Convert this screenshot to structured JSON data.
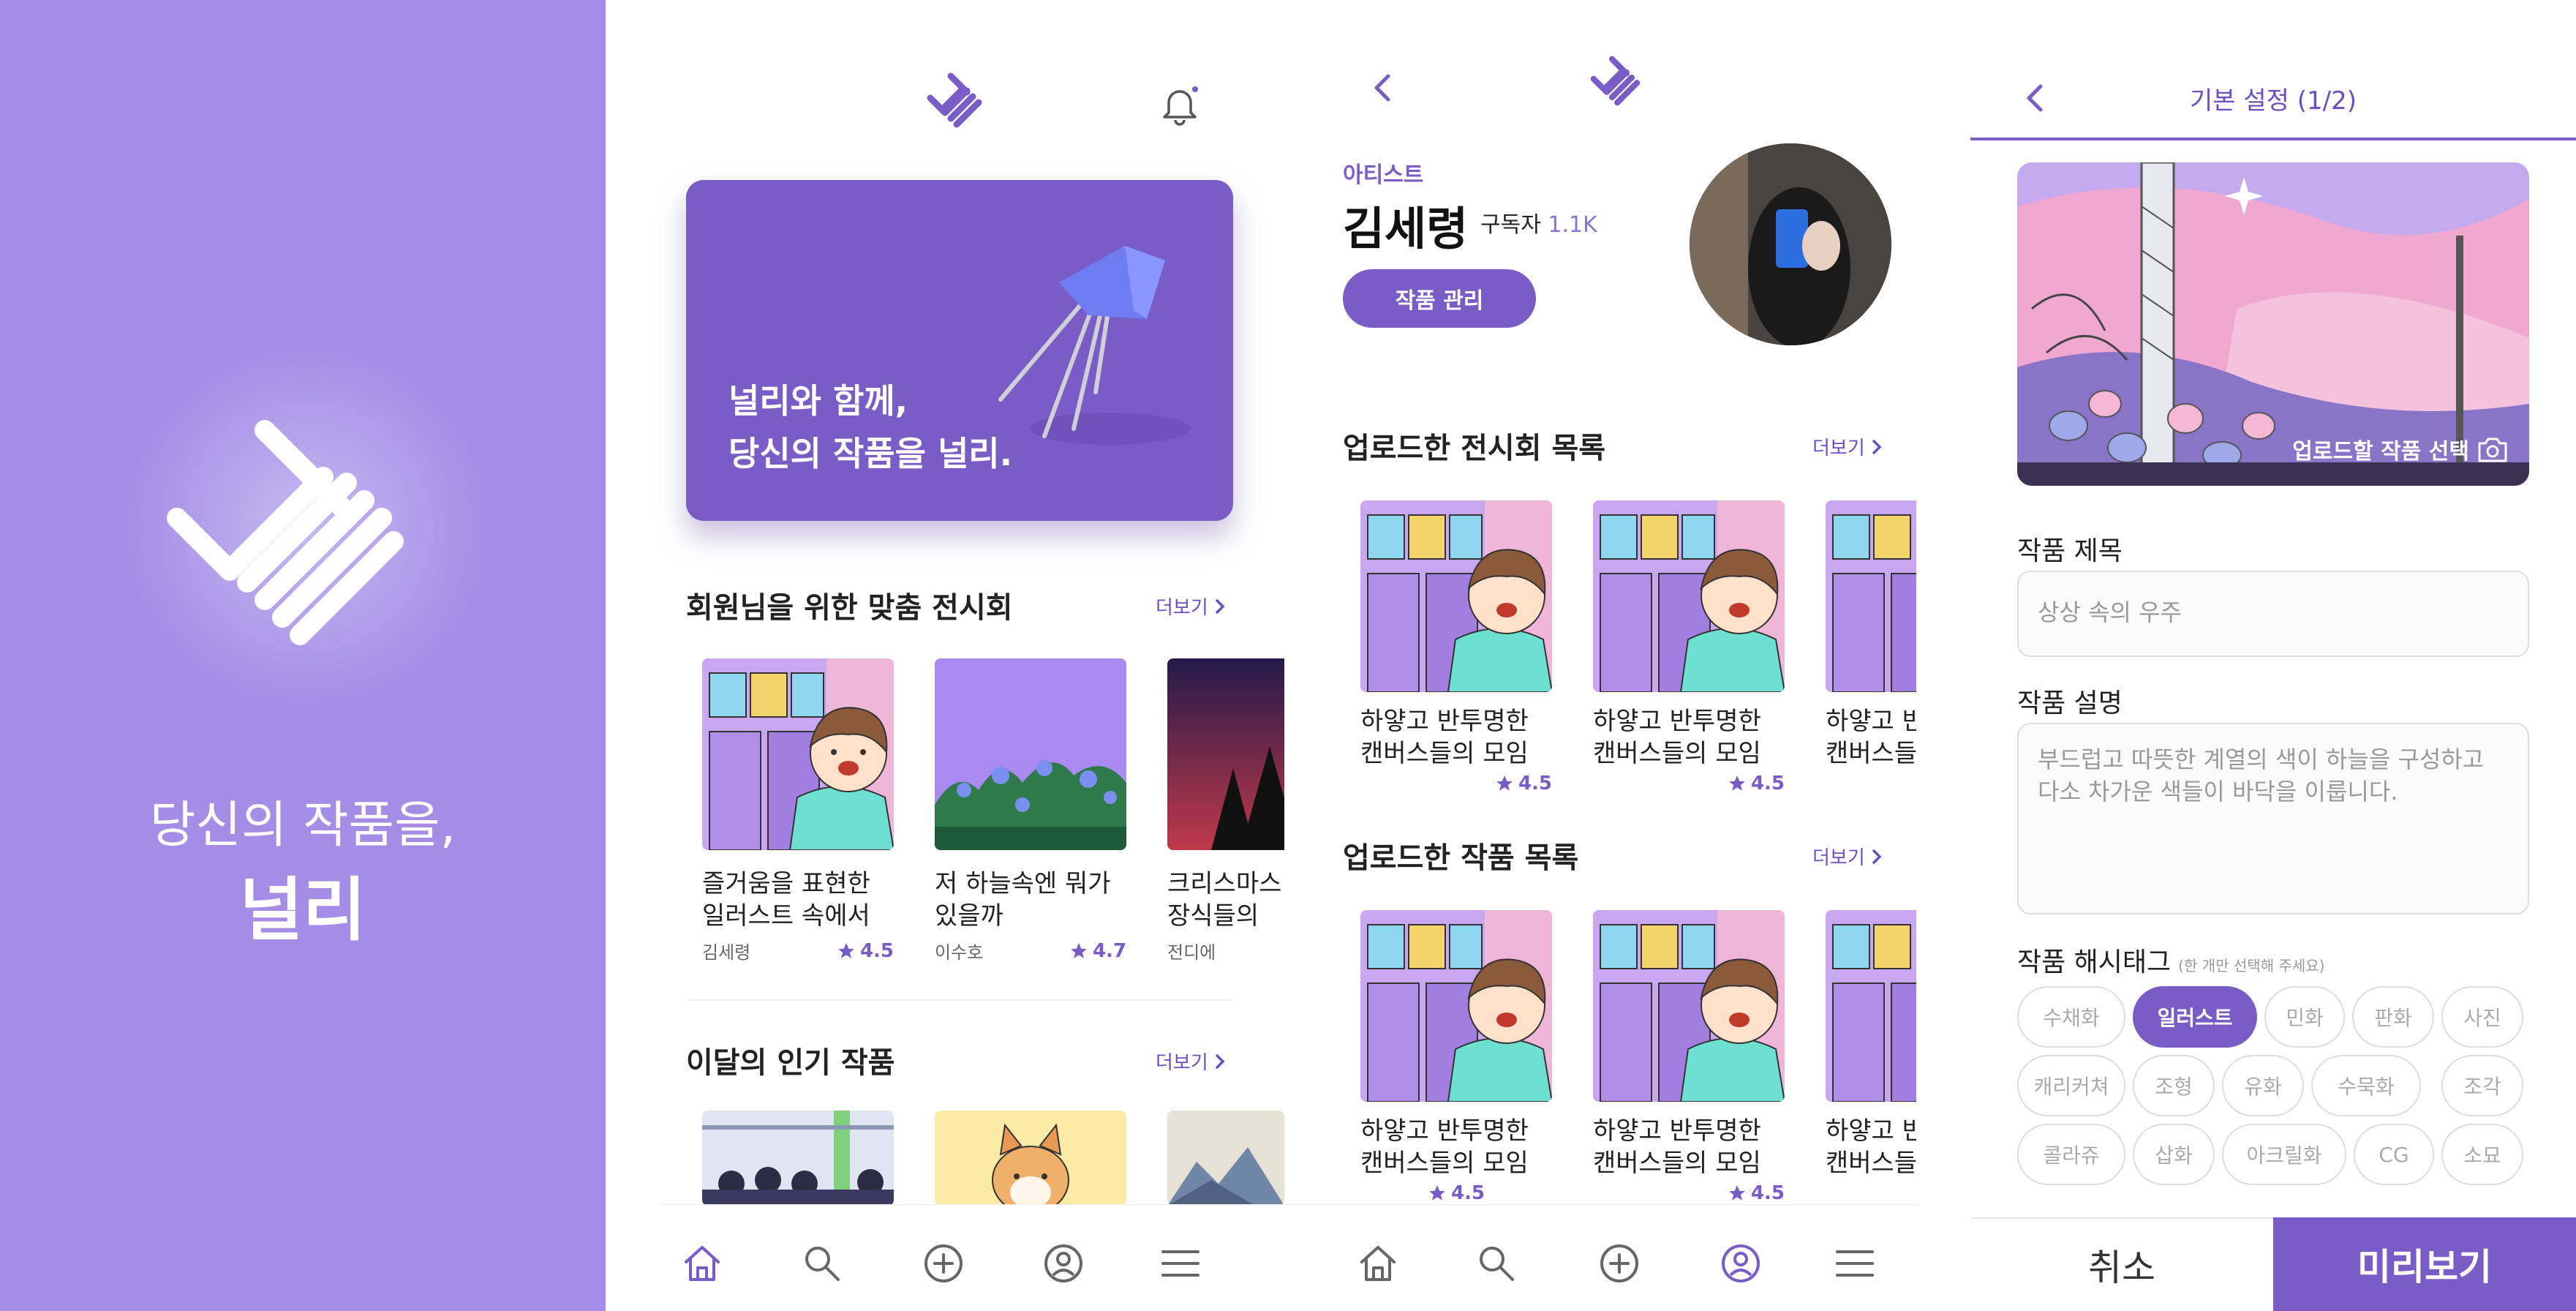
{
  "splash": {
    "tagline_line1": "당신의 작품을,",
    "tagline_line2": "널리"
  },
  "home": {
    "hero_line1": "널리와 함께,",
    "hero_line2": "당신의 작품을 널리.",
    "section1": {
      "title": "회원님을 위한 맞춤 전시회",
      "more": "더보기",
      "cards": [
        {
          "title1": "즐거움을 표현한",
          "title2": "일러스트 속에서",
          "author": "김세령",
          "rating": "4.5"
        },
        {
          "title1": "저 하늘속엔 뭐가",
          "title2": "있을까",
          "author": "이수호",
          "rating": "4.7"
        },
        {
          "title1": "크리스마스",
          "title2": "장식들의",
          "author": "전디에",
          "rating": ""
        }
      ]
    },
    "section2": {
      "title": "이달의 인기 작품",
      "more": "더보기"
    }
  },
  "artist": {
    "role": "아티스트",
    "name": "김세령",
    "subscribers_label": "구독자",
    "subscribers_count": "1.1K",
    "manage_button": "작품 관리",
    "exhibitions": {
      "title": "업로드한 전시회 목록",
      "more": "더보기",
      "cards": [
        {
          "title1": "하얗고 반투명한",
          "title2": "캔버스들의 모임",
          "rating": "4.5"
        },
        {
          "title1": "하얗고 반투명한",
          "title2": "캔버스들의 모임",
          "rating": "4.5"
        },
        {
          "title1": "하얗고 반투",
          "title2": "캔버스들의",
          "rating": ""
        }
      ]
    },
    "works": {
      "title": "업로드한 작품 목록",
      "more": "더보기",
      "cards": [
        {
          "title1": "하얗고 반투명한",
          "title2": "캔버스들의 모임",
          "rating": "4.5"
        },
        {
          "title1": "하얗고 반투명한",
          "title2": "캔버스들의 모임",
          "rating": "4.5"
        },
        {
          "title1": "하얗고 반투",
          "title2": "캔버스들의",
          "rating": ""
        }
      ]
    }
  },
  "upload": {
    "header_title": "기본 설정 (1/2)",
    "image_overlay": "업로드할 작품 선택",
    "title_label": "작품 제목",
    "title_placeholder": "상상 속의 우주",
    "desc_label": "작품 설명",
    "desc_placeholder": "부드럽고 따뜻한 계열의 색이 하늘을 구성하고 다소 차가운 색들이 바닥을 이룹니다.",
    "hashtag_label": "작품 해시태그",
    "hashtag_hint": "(한 개만 선택해 주세요)",
    "chips": [
      "수채화",
      "일러스트",
      "민화",
      "판화",
      "사진",
      "캐리커쳐",
      "조형",
      "유화",
      "수묵화",
      "조각",
      "콜라쥬",
      "삽화",
      "아크릴화",
      "CG",
      "소묘"
    ],
    "selected_chip": "일러스트",
    "cancel": "취소",
    "preview": "미리보기"
  },
  "colors": {
    "brand": "#7a5cc6",
    "splash_bg": "#a58ce6"
  }
}
